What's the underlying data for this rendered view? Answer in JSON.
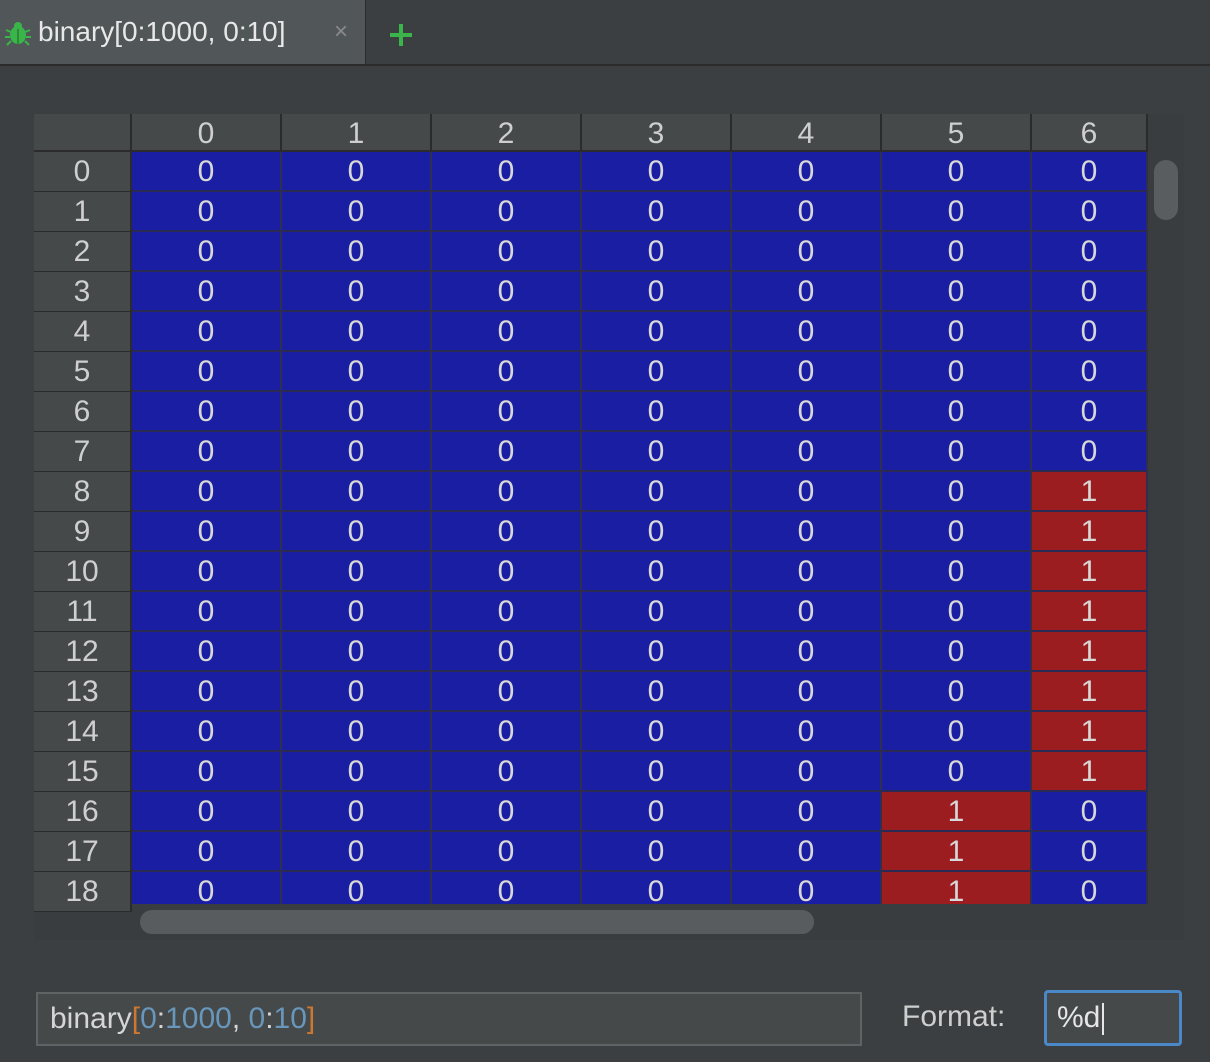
{
  "tab": {
    "title": "binary[0:1000, 0:10]",
    "close_glyph": "×",
    "icon": "bug-icon",
    "add_icon": "plus-icon"
  },
  "colors": {
    "zero_cell": "#1a1ea3",
    "one_cell": "#9b1d20",
    "accent_green": "#39b54a",
    "focus_border": "#4a88c7"
  },
  "grid": {
    "columns": [
      "0",
      "1",
      "2",
      "3",
      "4",
      "5",
      "6"
    ],
    "rows": [
      {
        "label": "0",
        "values": [
          0,
          0,
          0,
          0,
          0,
          0,
          0
        ]
      },
      {
        "label": "1",
        "values": [
          0,
          0,
          0,
          0,
          0,
          0,
          0
        ]
      },
      {
        "label": "2",
        "values": [
          0,
          0,
          0,
          0,
          0,
          0,
          0
        ]
      },
      {
        "label": "3",
        "values": [
          0,
          0,
          0,
          0,
          0,
          0,
          0
        ]
      },
      {
        "label": "4",
        "values": [
          0,
          0,
          0,
          0,
          0,
          0,
          0
        ]
      },
      {
        "label": "5",
        "values": [
          0,
          0,
          0,
          0,
          0,
          0,
          0
        ]
      },
      {
        "label": "6",
        "values": [
          0,
          0,
          0,
          0,
          0,
          0,
          0
        ]
      },
      {
        "label": "7",
        "values": [
          0,
          0,
          0,
          0,
          0,
          0,
          0
        ]
      },
      {
        "label": "8",
        "values": [
          0,
          0,
          0,
          0,
          0,
          0,
          1
        ]
      },
      {
        "label": "9",
        "values": [
          0,
          0,
          0,
          0,
          0,
          0,
          1
        ]
      },
      {
        "label": "10",
        "values": [
          0,
          0,
          0,
          0,
          0,
          0,
          1
        ]
      },
      {
        "label": "11",
        "values": [
          0,
          0,
          0,
          0,
          0,
          0,
          1
        ]
      },
      {
        "label": "12",
        "values": [
          0,
          0,
          0,
          0,
          0,
          0,
          1
        ]
      },
      {
        "label": "13",
        "values": [
          0,
          0,
          0,
          0,
          0,
          0,
          1
        ]
      },
      {
        "label": "14",
        "values": [
          0,
          0,
          0,
          0,
          0,
          0,
          1
        ]
      },
      {
        "label": "15",
        "values": [
          0,
          0,
          0,
          0,
          0,
          0,
          1
        ]
      },
      {
        "label": "16",
        "values": [
          0,
          0,
          0,
          0,
          0,
          1,
          0
        ]
      },
      {
        "label": "17",
        "values": [
          0,
          0,
          0,
          0,
          0,
          1,
          0
        ]
      },
      {
        "label": "18",
        "values": [
          0,
          0,
          0,
          0,
          0,
          1,
          0
        ]
      }
    ]
  },
  "expression": {
    "name": "binary",
    "open_bracket": "[",
    "start1": "0",
    "colon1": ":",
    "end1": "1000",
    "comma": ", ",
    "start2": "0",
    "colon2": ":",
    "end2": "10",
    "close_bracket": "]"
  },
  "format": {
    "label": "Format:",
    "value": "%d"
  }
}
